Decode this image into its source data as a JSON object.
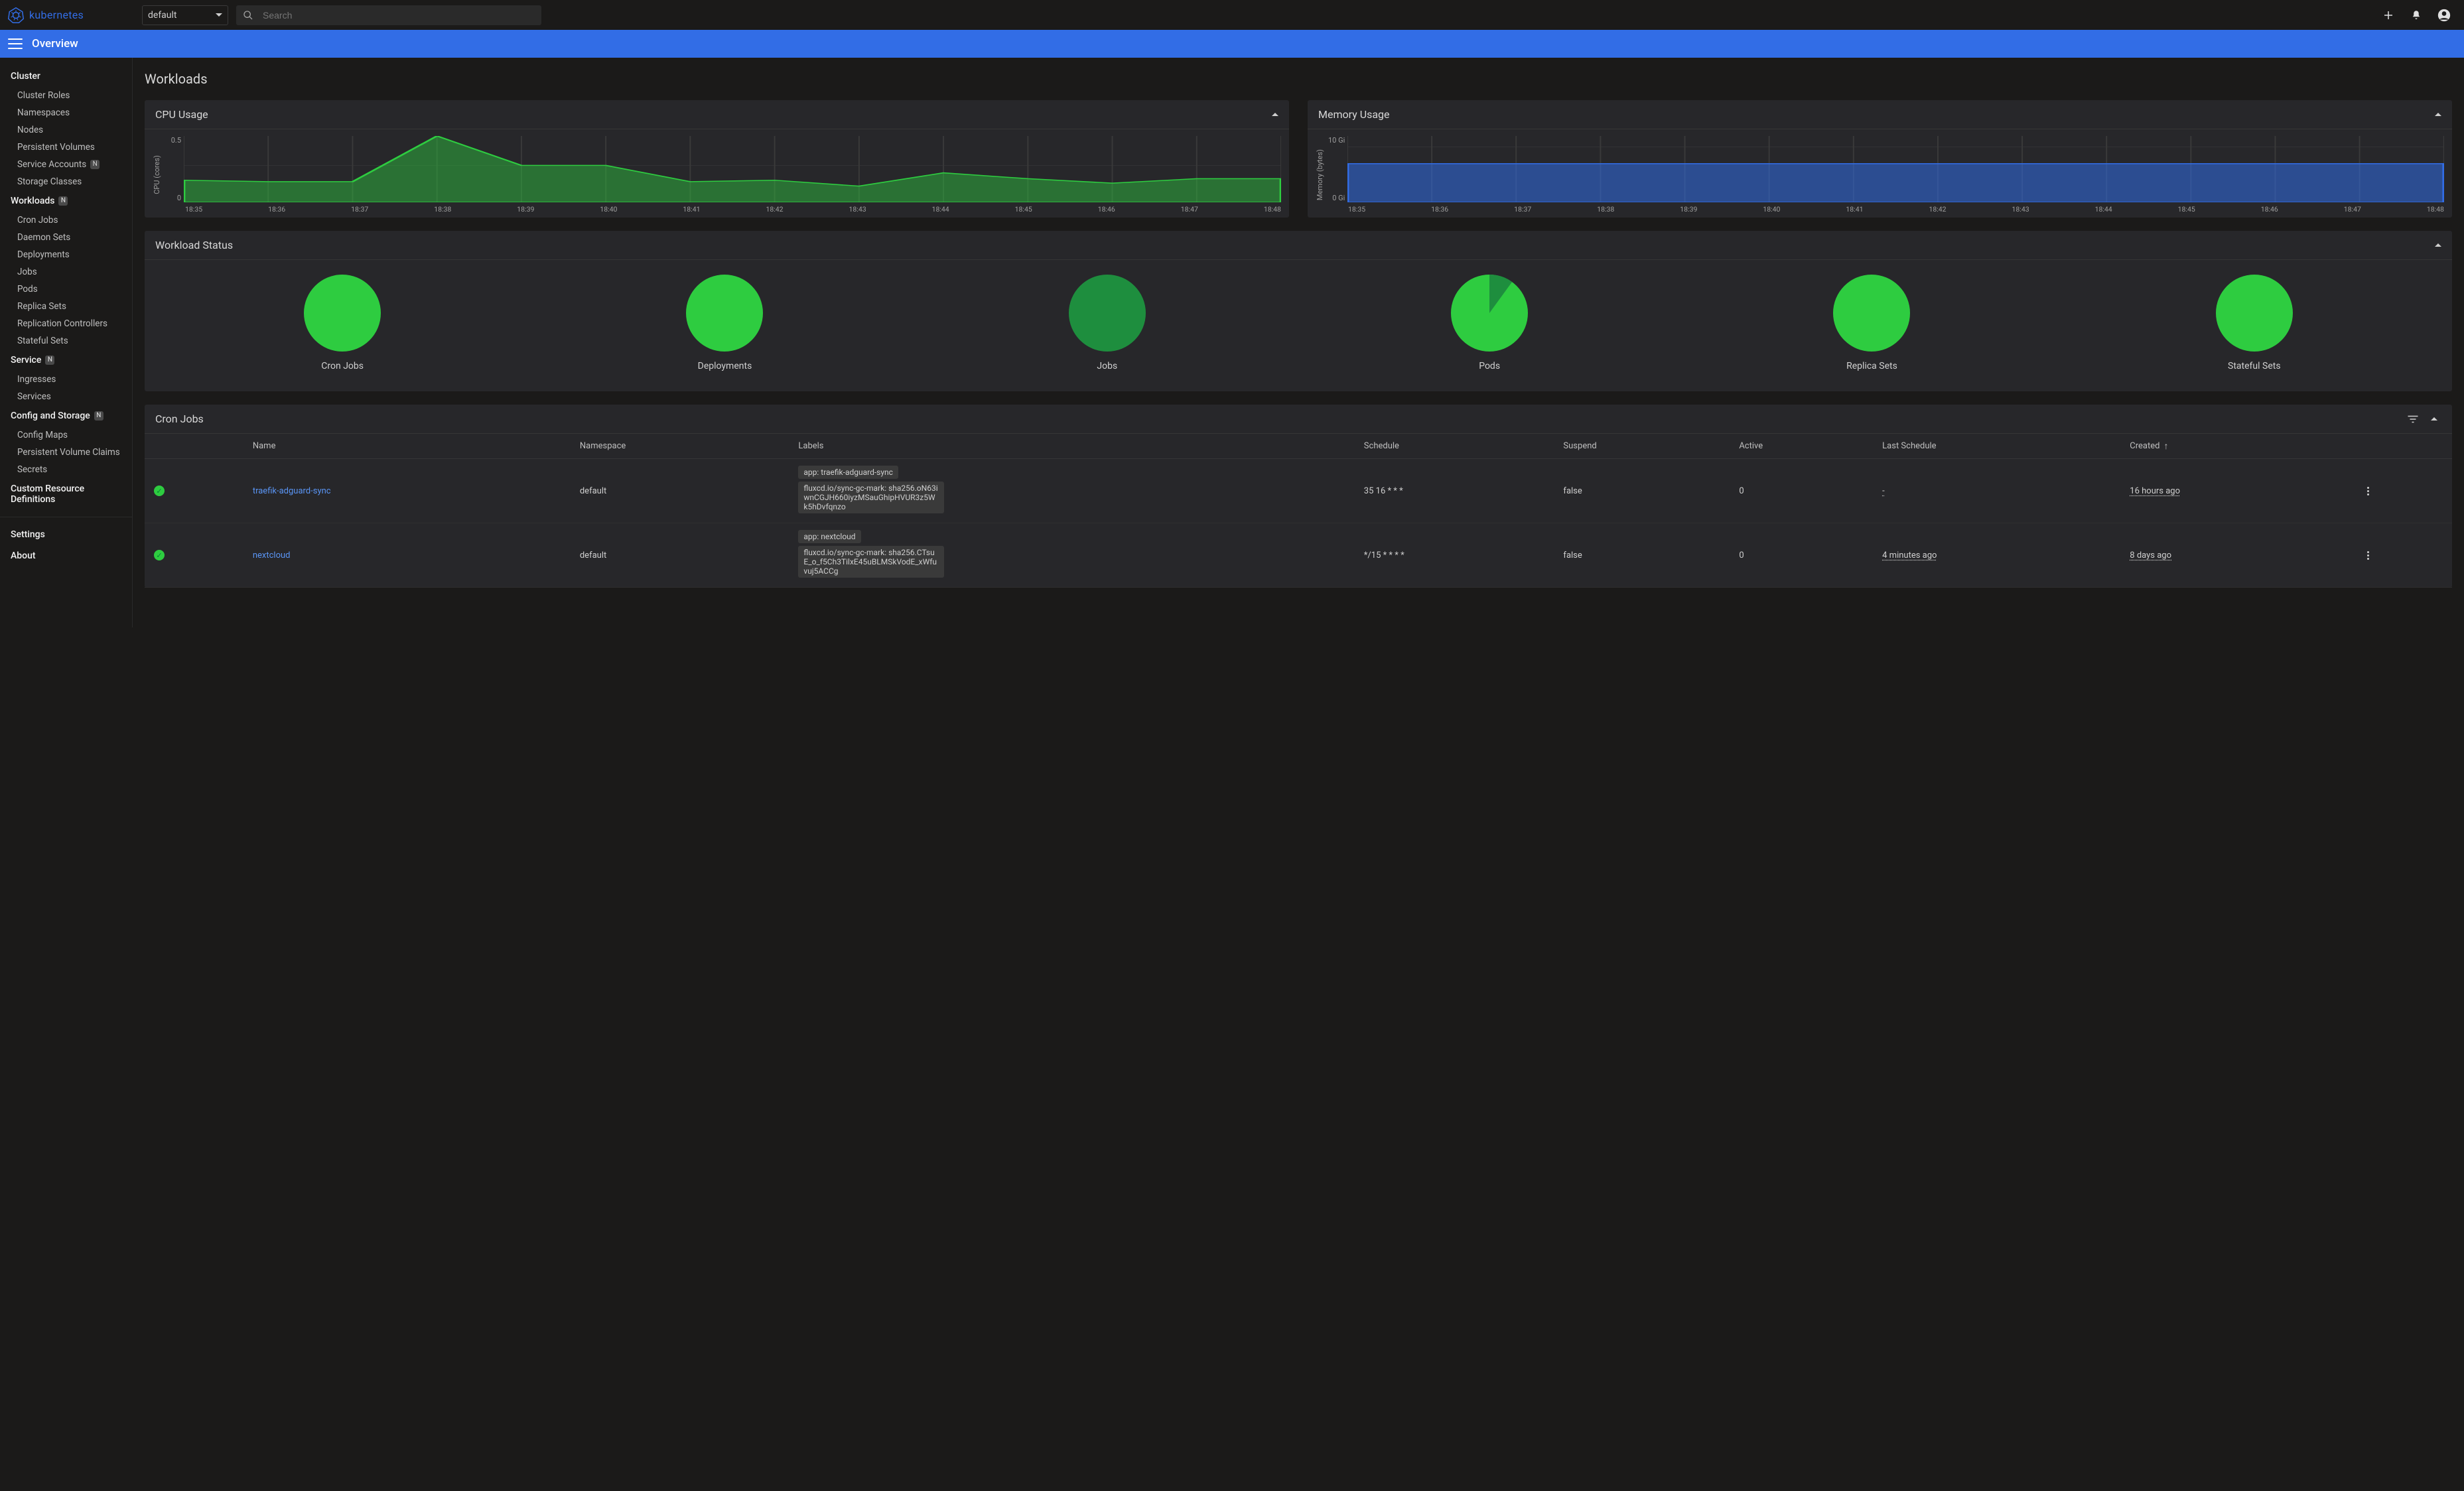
{
  "brand": "kubernetes",
  "namespace_selected": "default",
  "search_placeholder": "Search",
  "overview": "Overview",
  "page_title": "Workloads",
  "sidebar": {
    "cluster": {
      "title": "Cluster",
      "items": [
        "Cluster Roles",
        "Namespaces",
        "Nodes",
        "Persistent Volumes",
        "Service Accounts",
        "Storage Classes"
      ],
      "badges": {
        "4": "N"
      }
    },
    "workloads": {
      "title": "Workloads",
      "badge": "N",
      "items": [
        "Cron Jobs",
        "Daemon Sets",
        "Deployments",
        "Jobs",
        "Pods",
        "Replica Sets",
        "Replication Controllers",
        "Stateful Sets"
      ]
    },
    "service": {
      "title": "Service",
      "badge": "N",
      "items": [
        "Ingresses",
        "Services"
      ]
    },
    "config": {
      "title": "Config and Storage",
      "badge": "N",
      "items": [
        "Config Maps",
        "Persistent Volume Claims",
        "Secrets"
      ]
    },
    "crd": {
      "title": "Custom Resource Definitions"
    },
    "footer": {
      "settings": "Settings",
      "about": "About"
    }
  },
  "cards": {
    "cpu_title": "CPU Usage",
    "mem_title": "Memory Usage",
    "status_title": "Workload Status",
    "cronjobs_title": "Cron Jobs"
  },
  "chart_data": [
    {
      "id": "cpu",
      "type": "area",
      "title": "CPU Usage",
      "ylabel": "CPU (cores)",
      "ylim": [
        0,
        0.9
      ],
      "yticks": [
        "0.5",
        "0"
      ],
      "x": [
        "18:35",
        "18:36",
        "18:37",
        "18:38",
        "18:39",
        "18:40",
        "18:41",
        "18:42",
        "18:43",
        "18:44",
        "18:45",
        "18:46",
        "18:47",
        "18:48"
      ],
      "values": [
        0.3,
        0.28,
        0.28,
        0.9,
        0.5,
        0.5,
        0.28,
        0.3,
        0.22,
        0.4,
        0.32,
        0.26,
        0.32,
        0.32
      ]
    },
    {
      "id": "mem",
      "type": "area",
      "title": "Memory Usage",
      "ylabel": "Memory (bytes)",
      "ylim": [
        0,
        12
      ],
      "yticks": [
        "10 Gi",
        "0 Gi"
      ],
      "x": [
        "18:35",
        "18:36",
        "18:37",
        "18:38",
        "18:39",
        "18:40",
        "18:41",
        "18:42",
        "18:43",
        "18:44",
        "18:45",
        "18:46",
        "18:47",
        "18:48"
      ],
      "values": [
        7,
        7,
        7,
        7,
        7,
        7,
        7,
        7,
        7,
        7,
        7,
        7,
        7,
        7
      ]
    }
  ],
  "workload_status": [
    {
      "label": "Cron Jobs",
      "running": 1.0,
      "other": 0.0
    },
    {
      "label": "Deployments",
      "running": 1.0,
      "other": 0.0
    },
    {
      "label": "Jobs",
      "running": 0.0,
      "other": 1.0,
      "other_color": "#1e8e3e"
    },
    {
      "label": "Pods",
      "running": 0.9,
      "other": 0.1,
      "other_color": "#1e8e3e"
    },
    {
      "label": "Replica Sets",
      "running": 1.0,
      "other": 0.0
    },
    {
      "label": "Stateful Sets",
      "running": 1.0,
      "other": 0.0
    }
  ],
  "cronjobs": {
    "columns": [
      "",
      "Name",
      "Namespace",
      "Labels",
      "Schedule",
      "Suspend",
      "Active",
      "Last Schedule",
      "Created",
      ""
    ],
    "sort_col": "Created",
    "rows": [
      {
        "name": "traefik-adguard-sync",
        "namespace": "default",
        "labels": [
          "app: traefik-adguard-sync",
          "fluxcd.io/sync-gc-mark: sha256.oN63iwnCGJH660iyzMSauGhipHVUR3z5Wk5hDvfqnzo"
        ],
        "schedule": "35 16 * * *",
        "suspend": "false",
        "active": "0",
        "last_schedule": "-",
        "created": "16 hours ago"
      },
      {
        "name": "nextcloud",
        "namespace": "default",
        "labels": [
          "app: nextcloud",
          "fluxcd.io/sync-gc-mark: sha256.CTsuE_o_f5Ch3TilxE45uBLMSkVodE_xWfuvuj5ACCg"
        ],
        "schedule": "*/15 * * * *",
        "suspend": "false",
        "active": "0",
        "last_schedule": "4 minutes ago",
        "created": "8 days ago"
      }
    ]
  }
}
